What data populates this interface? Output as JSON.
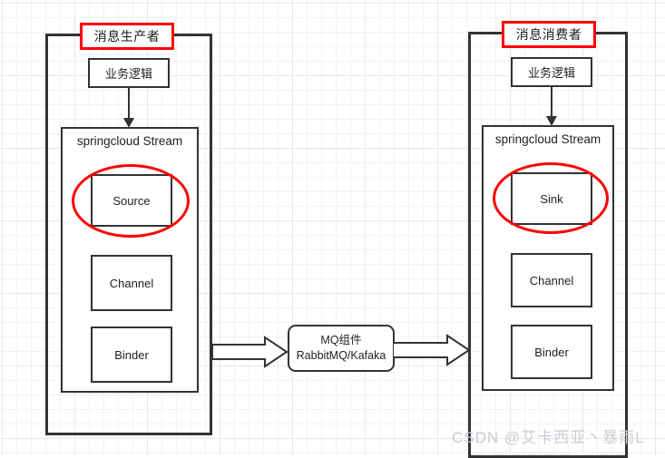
{
  "diagram": {
    "title_producer": "消息生产者",
    "title_consumer": "消息消费者",
    "producer": {
      "business_logic": "业务逻辑",
      "stream_label": "springcloud Stream",
      "components": [
        {
          "label": "Source",
          "highlighted": true
        },
        {
          "label": "Channel",
          "highlighted": false
        },
        {
          "label": "Binder",
          "highlighted": false
        }
      ]
    },
    "consumer": {
      "business_logic": "业务逻辑",
      "stream_label": "springcloud Stream",
      "components": [
        {
          "label": "Sink",
          "highlighted": true
        },
        {
          "label": "Channel",
          "highlighted": false
        },
        {
          "label": "Binder",
          "highlighted": false
        }
      ]
    },
    "middleware": {
      "line1": "MQ组件",
      "line2": "RabbitMQ/Kafaka"
    },
    "colors": {
      "highlight": "#ff0000",
      "stroke": "#333333",
      "grid_minor": "#f2f2f2",
      "grid_major": "#e8e8e8",
      "background": "#ffffff",
      "watermark": "#c8ccd4"
    },
    "watermark": "CSDN @艾卡西亚丶暴雨L"
  }
}
